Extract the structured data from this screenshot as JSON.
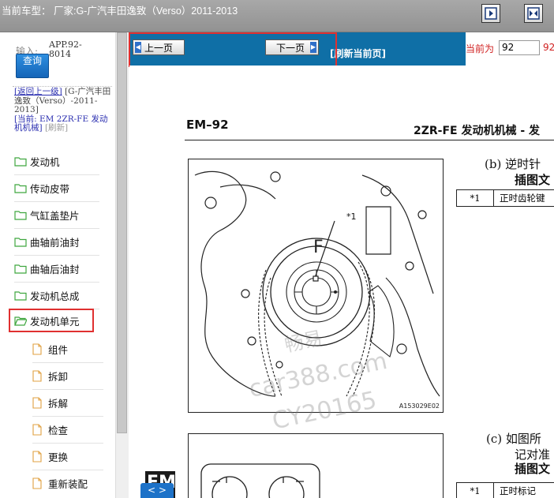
{
  "header": {
    "title": "当前车型： 厂家:G-广汽丰田逸致（Verso）2011-2013",
    "btn_collapse_icon": "panel-collapse-icon",
    "btn_split_icon": "panel-split-icon"
  },
  "search": {
    "label": "输入:",
    "value": "APP.92-8014",
    "button": "查询"
  },
  "breadcrumb": {
    "back_link": "[返回上一级]",
    "back_target": "[G-广汽丰田逸致（Verso）-2011-2013]",
    "current_label": "[当前:",
    "current_value": "EM 2ZR-FE 发动机机械]",
    "refresh": "[刷新]"
  },
  "tree": {
    "items": [
      {
        "label": "发动机"
      },
      {
        "label": "传动皮带"
      },
      {
        "label": "气缸盖垫片"
      },
      {
        "label": "曲轴前油封"
      },
      {
        "label": "曲轴后油封"
      },
      {
        "label": "发动机总成"
      },
      {
        "label": "发动机单元"
      }
    ],
    "children": [
      {
        "label": "组件"
      },
      {
        "label": "拆卸"
      },
      {
        "label": "拆解"
      },
      {
        "label": "检查"
      },
      {
        "label": "更换"
      },
      {
        "label": "重新装配"
      }
    ]
  },
  "toolbar": {
    "prev": "上一页",
    "next": "下一页",
    "refresh": "[刷新当前页]",
    "current_label": "当前为",
    "current_page": "92",
    "total": "92"
  },
  "document": {
    "page_number": "EM–92",
    "section_title": "2ZR-FE 发动机机械 - 发",
    "step_b": "(b)   逆时针",
    "step_b_bold": "插图文",
    "table_b": {
      "num": "*1",
      "text": "正时齿轮键"
    },
    "callout": "*1",
    "figure_letter": "F",
    "figure_code": "A153029E02",
    "step_c": "(c)   如图所",
    "step_c_line2": "记对准",
    "step_c_bold": "插图文",
    "table_c": {
      "num": "*1",
      "text": "正时标记"
    },
    "watermark_1": "畅易",
    "watermark_2": "car388.com",
    "watermark_3": "CY20165",
    "em_tab": "EM",
    "pager": "< >"
  }
}
